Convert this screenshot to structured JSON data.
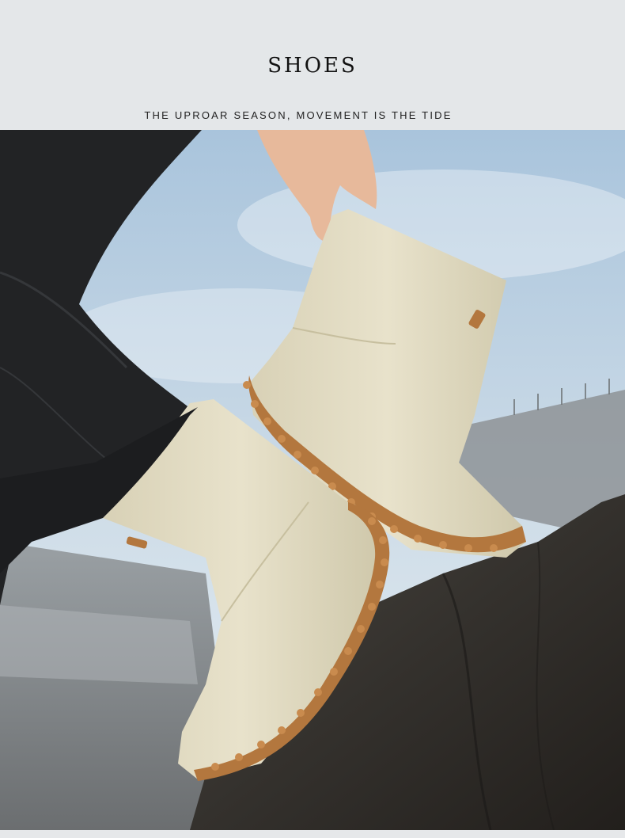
{
  "header": {
    "title": "SHOES",
    "subtitle": "THE UPROAR SEASON, MOVEMENT IS THE TIDE"
  },
  "photo": {
    "icon": "product-photo-rain-boots",
    "colors": {
      "sky_top": "#a9c4dc",
      "sky_bottom": "#e6eef3",
      "boot": "#e3dcc4",
      "boot_shadow": "#cbc3a6",
      "sole": "#b3773e",
      "rock": "#3a3631",
      "trousers": "#222325",
      "skin": "#e7b99b"
    }
  }
}
